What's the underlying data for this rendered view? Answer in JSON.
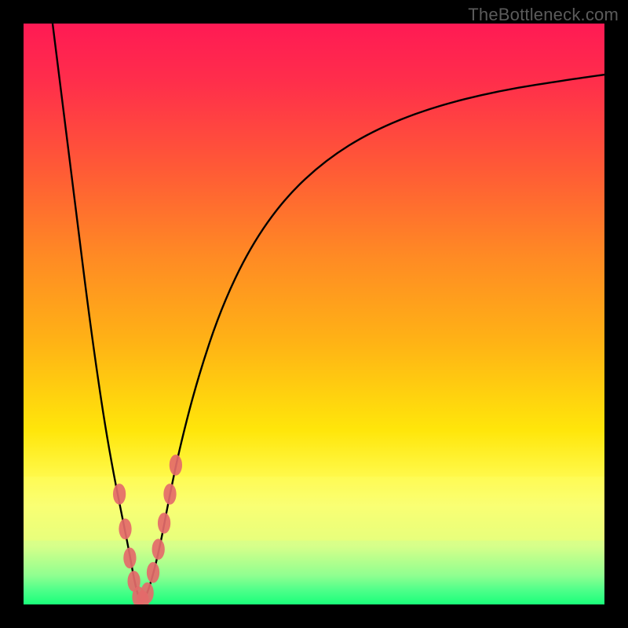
{
  "watermark": "TheBottleneck.com",
  "chart_data": {
    "type": "line",
    "title": "",
    "xlabel": "",
    "ylabel": "",
    "xlim": [
      0,
      100
    ],
    "ylim": [
      0,
      100
    ],
    "grid": false,
    "legend": false,
    "gradient_stops": [
      {
        "offset": 0.0,
        "color": "#ff1a54"
      },
      {
        "offset": 0.1,
        "color": "#ff2e4b"
      },
      {
        "offset": 0.25,
        "color": "#ff5a36"
      },
      {
        "offset": 0.4,
        "color": "#ff8a24"
      },
      {
        "offset": 0.55,
        "color": "#ffb315"
      },
      {
        "offset": 0.7,
        "color": "#ffe60a"
      },
      {
        "offset": 0.78,
        "color": "#fff94a"
      },
      {
        "offset": 0.83,
        "color": "#f7ff7a"
      },
      {
        "offset": 0.9,
        "color": "#d6ff8a"
      },
      {
        "offset": 0.95,
        "color": "#90ff90"
      },
      {
        "offset": 0.975,
        "color": "#4fff8a"
      },
      {
        "offset": 1.0,
        "color": "#1aff7a"
      }
    ],
    "band_top_fraction": 0.78,
    "series": [
      {
        "name": "bottleneck-curve",
        "color": "#000000",
        "x": [
          5.0,
          6.5,
          8.0,
          9.5,
          11.0,
          12.5,
          14.0,
          15.5,
          17.0,
          18.2,
          19.0,
          19.7,
          20.3,
          21.0,
          22.0,
          23.5,
          25.0,
          27.0,
          30.0,
          34.0,
          39.0,
          45.0,
          52.0,
          60.0,
          70.0,
          82.0,
          95.0,
          100.0
        ],
        "y": [
          100.0,
          88.0,
          76.0,
          64.0,
          52.0,
          41.0,
          31.0,
          22.5,
          15.0,
          9.0,
          4.5,
          1.5,
          0.4,
          1.2,
          4.0,
          10.0,
          18.0,
          27.5,
          39.0,
          51.0,
          61.5,
          70.0,
          76.5,
          81.5,
          85.5,
          88.5,
          90.5,
          91.2
        ]
      }
    ],
    "markers": {
      "name": "highlighted-points",
      "color": "#e46a6a",
      "rx": 1.1,
      "ry": 1.8,
      "points": [
        {
          "x": 16.5,
          "y": 19.0
        },
        {
          "x": 17.5,
          "y": 13.0
        },
        {
          "x": 18.3,
          "y": 8.0
        },
        {
          "x": 19.0,
          "y": 4.0
        },
        {
          "x": 19.8,
          "y": 1.3
        },
        {
          "x": 20.5,
          "y": 0.6
        },
        {
          "x": 21.3,
          "y": 2.0
        },
        {
          "x": 22.3,
          "y": 5.5
        },
        {
          "x": 23.2,
          "y": 9.5
        },
        {
          "x": 24.2,
          "y": 14.0
        },
        {
          "x": 25.2,
          "y": 19.0
        },
        {
          "x": 26.2,
          "y": 24.0
        }
      ]
    }
  }
}
